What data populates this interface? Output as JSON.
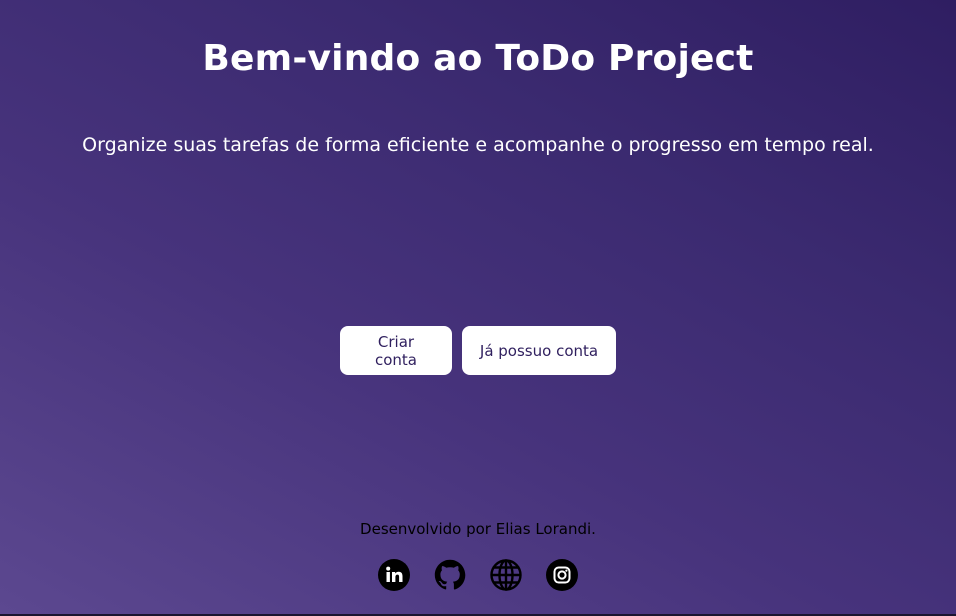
{
  "header": {
    "title": "Bem-vindo ao ToDo Project",
    "subtitle": "Organize suas tarefas de forma eficiente e acompanhe o progresso em tempo real."
  },
  "actions": {
    "create_label": "Criar conta",
    "login_label": "Já possuo conta"
  },
  "footer": {
    "credit": "Desenvolvido por Elias Lorandi.",
    "social": [
      {
        "icon": "linkedin-icon"
      },
      {
        "icon": "github-icon"
      },
      {
        "icon": "globe-icon"
      },
      {
        "icon": "instagram-icon"
      }
    ]
  },
  "colors": {
    "gradient_light": "#5c4890",
    "gradient_dark": "#2f1e62",
    "button_bg": "#ffffff",
    "button_text": "#2f1f5e"
  }
}
